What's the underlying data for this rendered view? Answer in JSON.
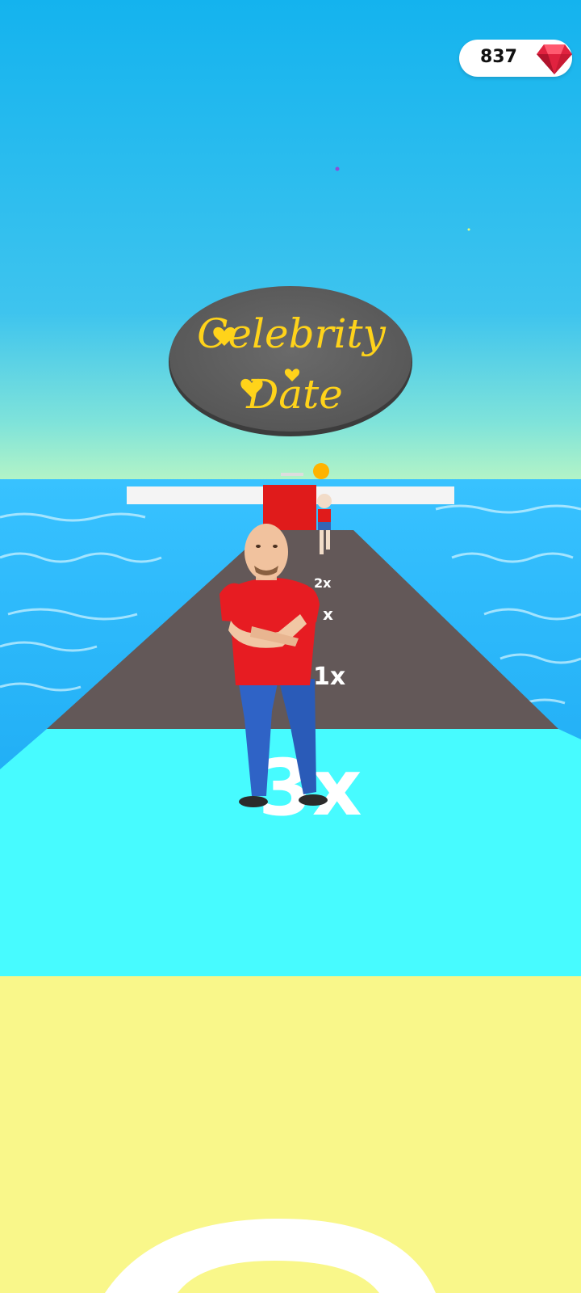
{
  "hud": {
    "gem_count": "837",
    "gem_icon": "ruby-gem-icon",
    "gem_color": "#e0223f"
  },
  "sign": {
    "line1": "Celebrity",
    "line2": "Date"
  },
  "track": {
    "multipliers": [
      "1x",
      "2x",
      "3x"
    ],
    "tile_multiplier": "3x"
  },
  "colors": {
    "sky_top": "#12b4ee",
    "sky_horizon": "#aef2c8",
    "sea": "#1aa8ef",
    "road": "#635858",
    "tile_cyan": "#47fbff",
    "tile_yellow": "#f9f78a",
    "sign_gray": "#5f5f5f",
    "sign_text": "#ffd31a"
  }
}
